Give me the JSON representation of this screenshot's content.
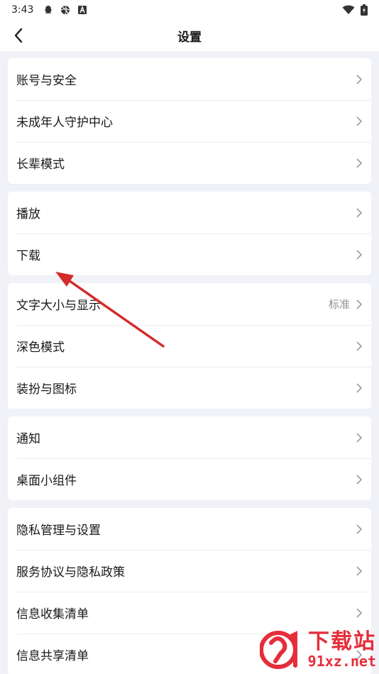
{
  "status_bar": {
    "time": "3:43",
    "left_icons": [
      "qq-penguin-icon",
      "aperture-icon",
      "a-box-icon"
    ],
    "right_icons": [
      "wifi-icon",
      "battery-charging-icon"
    ]
  },
  "header": {
    "title": "设置",
    "back_icon": "chevron-left-icon"
  },
  "groups": [
    {
      "items": [
        {
          "name": "account-security",
          "label": "账号与安全"
        },
        {
          "name": "minor-protection",
          "label": "未成年人守护中心"
        },
        {
          "name": "elder-mode",
          "label": "长辈模式"
        }
      ]
    },
    {
      "items": [
        {
          "name": "playback",
          "label": "播放"
        },
        {
          "name": "download",
          "label": "下载"
        }
      ]
    },
    {
      "items": [
        {
          "name": "font-size-display",
          "label": "文字大小与显示",
          "value": "标准"
        },
        {
          "name": "dark-mode",
          "label": "深色模式"
        },
        {
          "name": "theme-icon",
          "label": "装扮与图标"
        }
      ]
    },
    {
      "items": [
        {
          "name": "notifications",
          "label": "通知"
        },
        {
          "name": "desktop-widget",
          "label": "桌面小组件"
        }
      ]
    },
    {
      "items": [
        {
          "name": "privacy-settings",
          "label": "隐私管理与设置"
        },
        {
          "name": "service-agreement",
          "label": "服务协议与隐私政策"
        },
        {
          "name": "info-collection-list",
          "label": "信息收集清单"
        },
        {
          "name": "info-sharing-list",
          "label": "信息共享清单"
        }
      ]
    }
  ],
  "annotation": {
    "color": "#d42a2a",
    "points_to": "下载"
  },
  "watermark": {
    "main": "下载站",
    "sub": "91xz.net",
    "color": "#e31d2a"
  }
}
